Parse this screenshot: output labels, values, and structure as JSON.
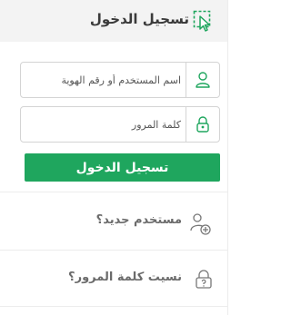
{
  "header": {
    "title": "تسجيل الدخول",
    "icon": "login-cursor-icon"
  },
  "form": {
    "username_placeholder": "اسم المستخدم أو رقم الهوية",
    "username_value": "",
    "password_placeholder": "كلمة المرور",
    "password_value": "",
    "submit_label": "تسجيل الدخول"
  },
  "links": {
    "new_user": "مستخدم جديد؟",
    "forgot_password": "نسيت كلمة المرور؟"
  },
  "colors": {
    "accent": "#1fa65e",
    "header_bg": "#f3f3f3",
    "text": "#3a3a3a"
  }
}
